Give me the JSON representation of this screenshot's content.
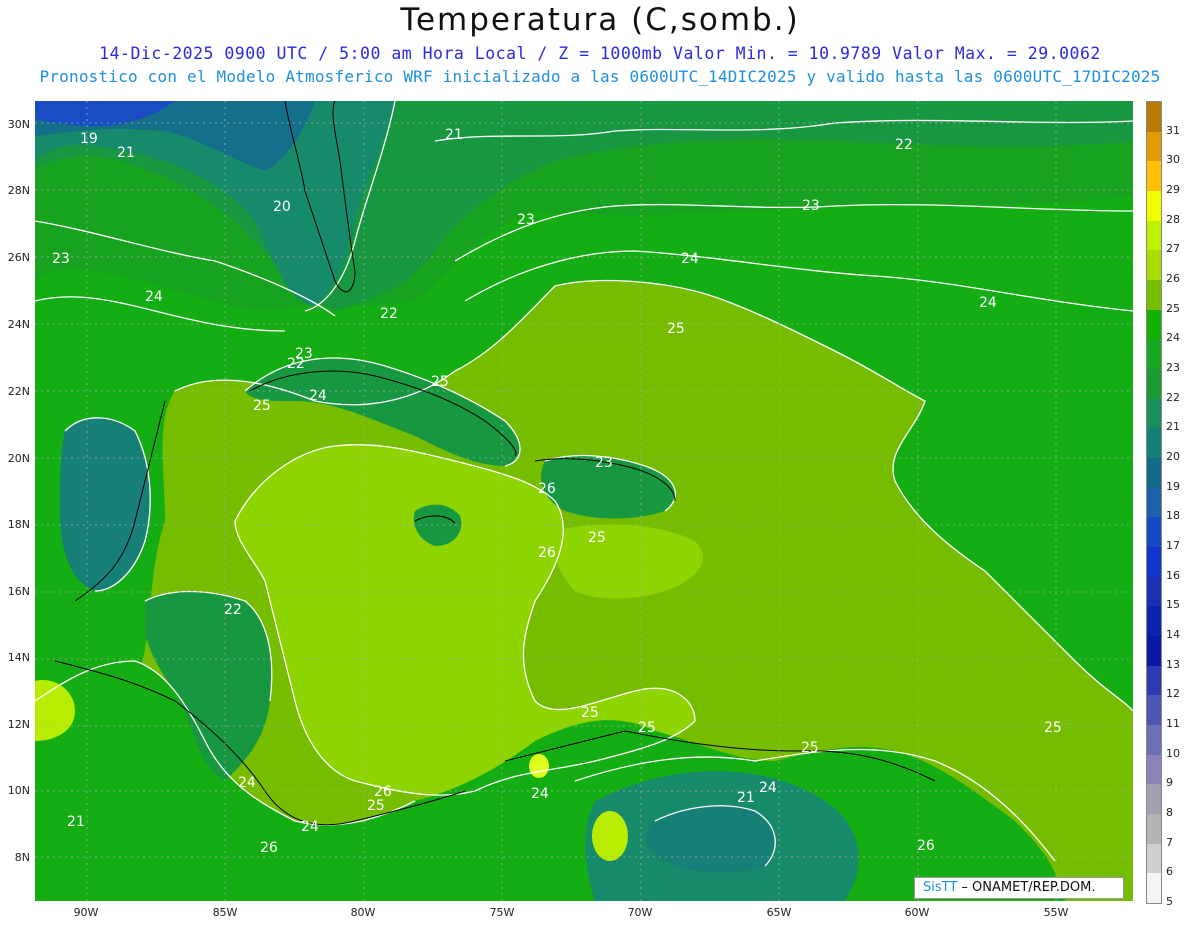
{
  "header": {
    "title": "Temperatura (C,somb.)",
    "subtitle_1": "14-Dic-2025  0900 UTC / 5:00 am Hora Local / Z = 1000mb   Valor Min. = 10.9789  Valor Max. = 29.0062",
    "subtitle_2": "Pronostico con el Modelo Atmosferico WRF inicializado a las 0600UTC_14DIC2025 y valido hasta las  0600UTC_17DIC2025"
  },
  "axes": {
    "lat_labels": [
      "30N",
      "28N",
      "26N",
      "24N",
      "22N",
      "20N",
      "18N",
      "16N",
      "14N",
      "12N",
      "10N",
      "8N"
    ],
    "lon_labels": [
      "90W",
      "85W",
      "80W",
      "75W",
      "70W",
      "65W",
      "60W",
      "55W"
    ]
  },
  "contour_labels": [
    "19",
    "21",
    "20",
    "21",
    "22",
    "23",
    "23",
    "24",
    "24",
    "22",
    "23",
    "25",
    "25",
    "24",
    "25",
    "26",
    "26",
    "23",
    "25",
    "22",
    "24",
    "25",
    "24",
    "25",
    "26",
    "25",
    "26",
    "21",
    "24",
    "25",
    "24",
    "26",
    "25",
    "21",
    "22",
    "23",
    "24"
  ],
  "colorbar": {
    "labels": [
      "31",
      "30",
      "29",
      "28",
      "27",
      "26",
      "25",
      "24",
      "23",
      "22",
      "21",
      "20",
      "19",
      "18",
      "17",
      "16",
      "15",
      "14",
      "13",
      "12",
      "11",
      "10",
      "9",
      "8",
      "7",
      "6",
      "5"
    ],
    "colors": [
      "#b87a00",
      "#e39a00",
      "#ffc000",
      "#f0ff00",
      "#bcf200",
      "#a7dc00",
      "#78be00",
      "#12b000",
      "#17a61f",
      "#1a9a33",
      "#16905a",
      "#167f76",
      "#136a8a",
      "#1d60b0",
      "#1549c5",
      "#1234cc",
      "#1a30b0",
      "#0a22b0",
      "#0a18a8",
      "#2d3ab4",
      "#4f55b3",
      "#6d70b3",
      "#8a82b8",
      "#9ea0b0",
      "#b4b4b4",
      "#cfcfcf",
      "#f3f3f3"
    ]
  },
  "credit": {
    "brand": "SisTT",
    "text": " – ONAMET/REP.DOM."
  },
  "colors": {
    "title": "#111111",
    "subtitle_1": "#2a2ae0",
    "subtitle_2": "#1f8fe0",
    "map_base": "#16a016",
    "warm_land": "#8fd400"
  }
}
